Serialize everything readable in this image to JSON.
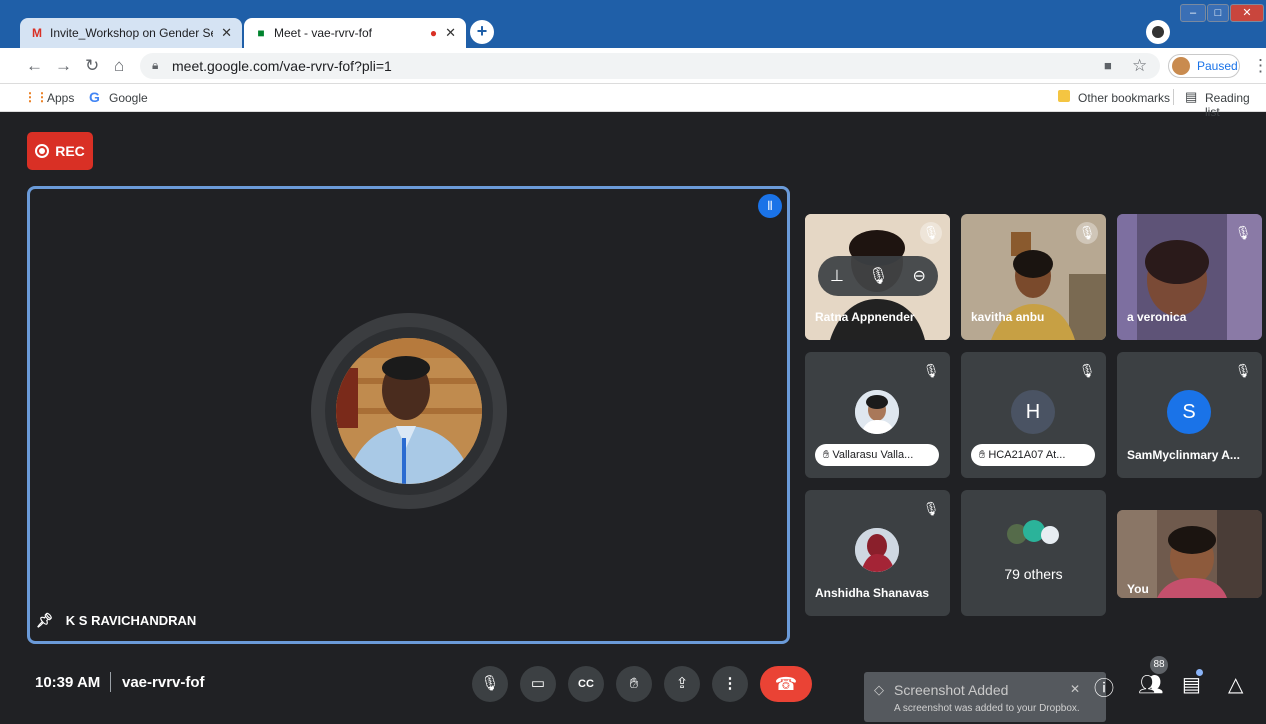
{
  "browser": {
    "tabs": [
      {
        "title": "Invite_Workshop on Gender Sens",
        "close": "✕"
      },
      {
        "title": "Meet - vae-rvrv-fof",
        "close": "✕"
      }
    ],
    "url": "meet.google.com/vae-rvrv-fof?pli=1",
    "profile_status": "Paused",
    "bookmarks": {
      "apps": "Apps",
      "google": "Google",
      "other": "Other bookmarks",
      "reading": "Reading list"
    }
  },
  "meet": {
    "rec_label": "REC",
    "main_speaker": "K S RAVICHANDRAN",
    "participants": [
      {
        "name": "Ratna Appnender"
      },
      {
        "name": "kavitha anbu"
      },
      {
        "name": "a veronica"
      },
      {
        "name": "Vallarasu Valla..."
      },
      {
        "name": "HCA21A07 At...",
        "initial": "H"
      },
      {
        "name": "SamMyclinmary A...",
        "initial": "S"
      },
      {
        "name": "Anshidha Shanavas"
      },
      {
        "name": "79 others"
      },
      {
        "name": "You"
      }
    ],
    "time": "10:39 AM",
    "meeting_code": "vae-rvrv-fof",
    "people_count": "88"
  },
  "toast": {
    "title": "Screenshot Added",
    "body": "A screenshot was added to your Dropbox."
  }
}
